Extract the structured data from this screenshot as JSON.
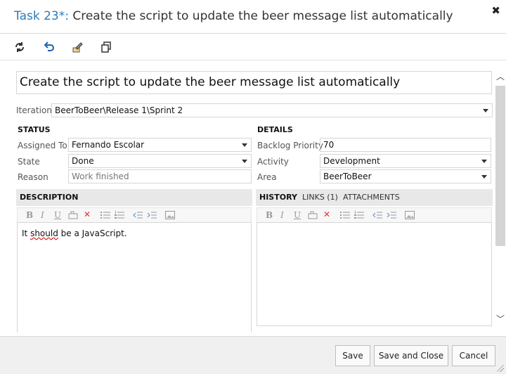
{
  "dialog": {
    "task_label": "Task 23*:",
    "title_text": "Create the script to update the beer message list automatically",
    "close_glyph": "✖"
  },
  "toolbar": {
    "icons": [
      "refresh-icon",
      "undo-icon",
      "edit-template-icon",
      "copy-icon"
    ]
  },
  "work_item": {
    "title": "Create the script to update the beer message list automatically"
  },
  "iteration": {
    "label": "Iteration",
    "value": "BeerToBeer\\Release 1\\Sprint 2"
  },
  "status": {
    "heading": "STATUS",
    "assigned_to": {
      "label": "Assigned To",
      "value": "Fernando Escolar"
    },
    "state": {
      "label": "State",
      "value": "Done"
    },
    "reason": {
      "label": "Reason",
      "value": "Work finished"
    }
  },
  "details": {
    "heading": "DETAILS",
    "backlog_priority": {
      "label": "Backlog Priority",
      "value": "70"
    },
    "activity": {
      "label": "Activity",
      "value": "Development"
    },
    "area": {
      "label": "Area",
      "value": "BeerToBeer"
    }
  },
  "description": {
    "heading": "DESCRIPTION",
    "text_prefix": "It ",
    "text_misspelled": "should",
    "text_suffix": " be a JavaScript."
  },
  "tabs": {
    "history": "HISTORY",
    "links": "LINKS (1)",
    "attachments": "ATTACHMENTS"
  },
  "editor_toolbar": {
    "bold": "B",
    "italic": "I",
    "underline": "U",
    "clear": "✕"
  },
  "footer": {
    "save": "Save",
    "save_close": "Save and Close",
    "cancel": "Cancel"
  },
  "colors": {
    "accent": "#2b7bb9",
    "panel_header": "#e8e8e8",
    "footer": "#f0f0f0"
  }
}
